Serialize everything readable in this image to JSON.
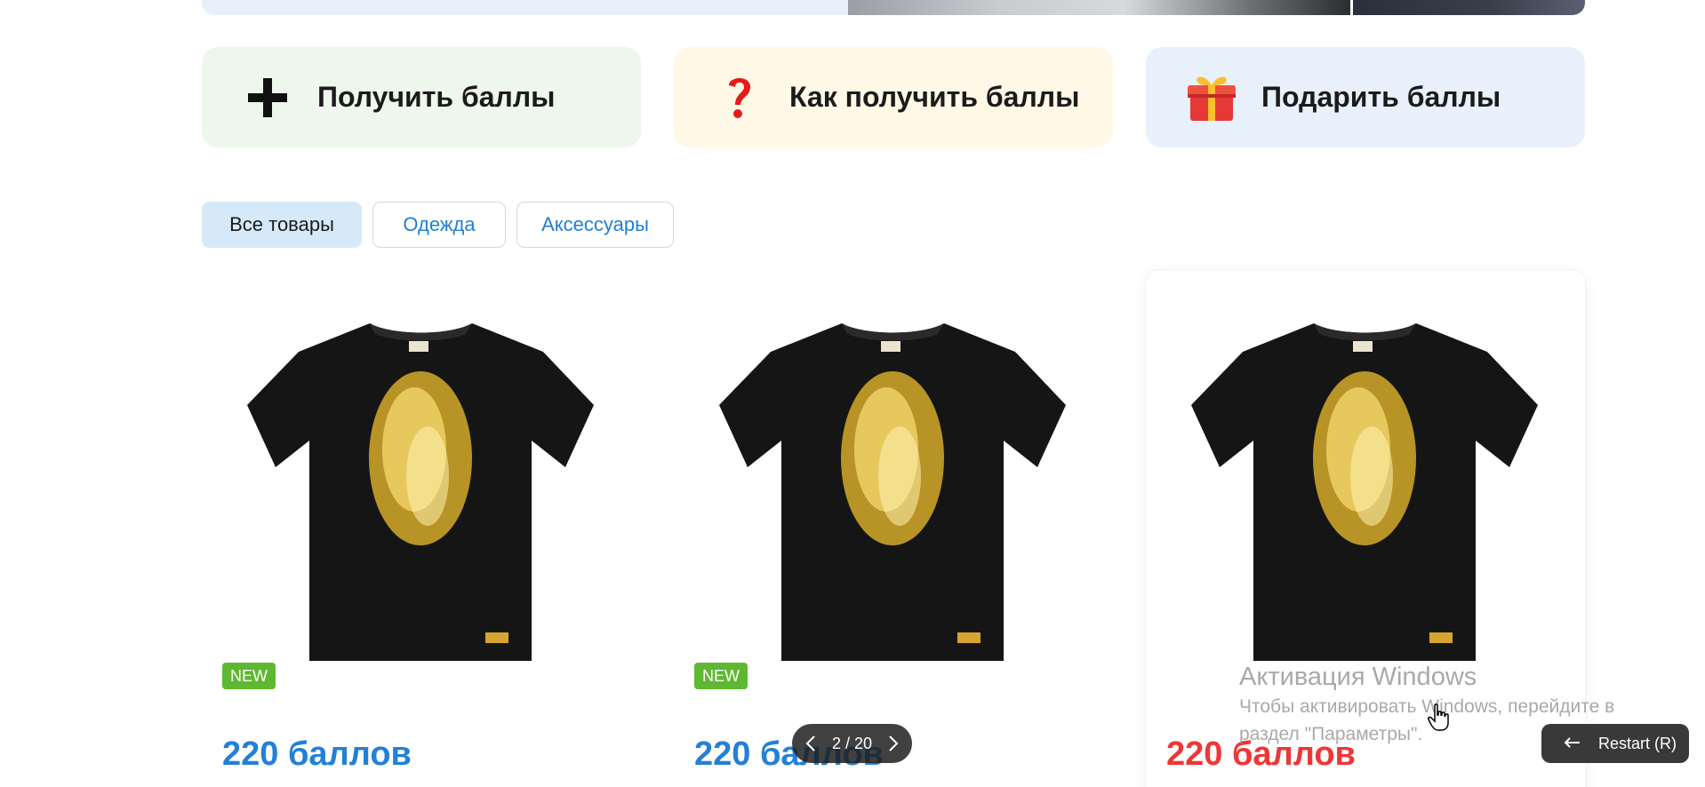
{
  "actions": {
    "earn_label": "Получить баллы",
    "how_label": "Как получить баллы",
    "gift_label": "Подарить баллы",
    "how_icon_glyph": "❓",
    "colors": {
      "earn_bg": "#eef7ec",
      "how_bg": "#fff8e6",
      "gift_bg": "#e8f0fb"
    }
  },
  "filters": {
    "all": "Все товары",
    "clothes": "Одежда",
    "accessories": "Аксессуары",
    "active": "all"
  },
  "products": [
    {
      "badge": "NEW",
      "price": "220 баллов",
      "price_color": "#2380d6"
    },
    {
      "badge": "NEW",
      "price": "220 баллов",
      "price_color": "#2380d6"
    },
    {
      "badge": "",
      "price": "220 баллов",
      "price_color": "#f03535"
    }
  ],
  "pager": {
    "text": "2 / 20"
  },
  "restart": {
    "label": "Restart (R)"
  },
  "watermark": {
    "title": "Активация Windows",
    "line1": "Чтобы активировать Windows, перейдите в",
    "line2": "раздел \"Параметры\"."
  },
  "colors": {
    "accent": "#2380d6",
    "sale": "#f03535",
    "badge": "#5fb832"
  }
}
